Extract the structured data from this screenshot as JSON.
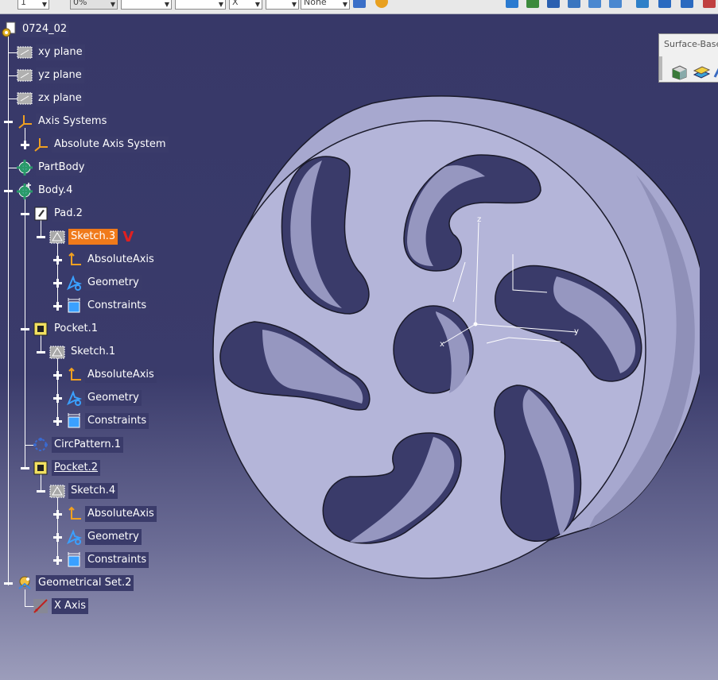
{
  "toolbar": {
    "fields": [
      "1",
      "0%",
      "",
      "",
      "X",
      "",
      "None"
    ]
  },
  "surface_panel": {
    "title": "Surface-Base"
  },
  "tree": {
    "root": "0724_02",
    "xy_plane": "xy plane",
    "yz_plane": "yz plane",
    "zx_plane": "zx plane",
    "axis_systems": "Axis Systems",
    "absolute_axis_system": "Absolute Axis System",
    "partbody": "PartBody",
    "body4": "Body.4",
    "pad2": "Pad.2",
    "sketch3": "Sketch.3",
    "check_mark": "V",
    "absolute_axis": "AbsoluteAxis",
    "geometry": "Geometry",
    "constraints": "Constraints",
    "pocket1": "Pocket.1",
    "sketch1": "Sketch.1",
    "circpattern1": "CircPattern.1",
    "pocket2": "Pocket.2",
    "sketch4": "Sketch.4",
    "geomset2": "Geometrical Set.2",
    "xaxis": "X Axis"
  },
  "viewer": {
    "axis_z": "z",
    "axis_y": "y",
    "axis_x": "x"
  },
  "colors": {
    "background": "#373868",
    "selected": "#f07a1a",
    "part_face": "#b4b5d9",
    "part_edge": "#1a1a2a"
  }
}
